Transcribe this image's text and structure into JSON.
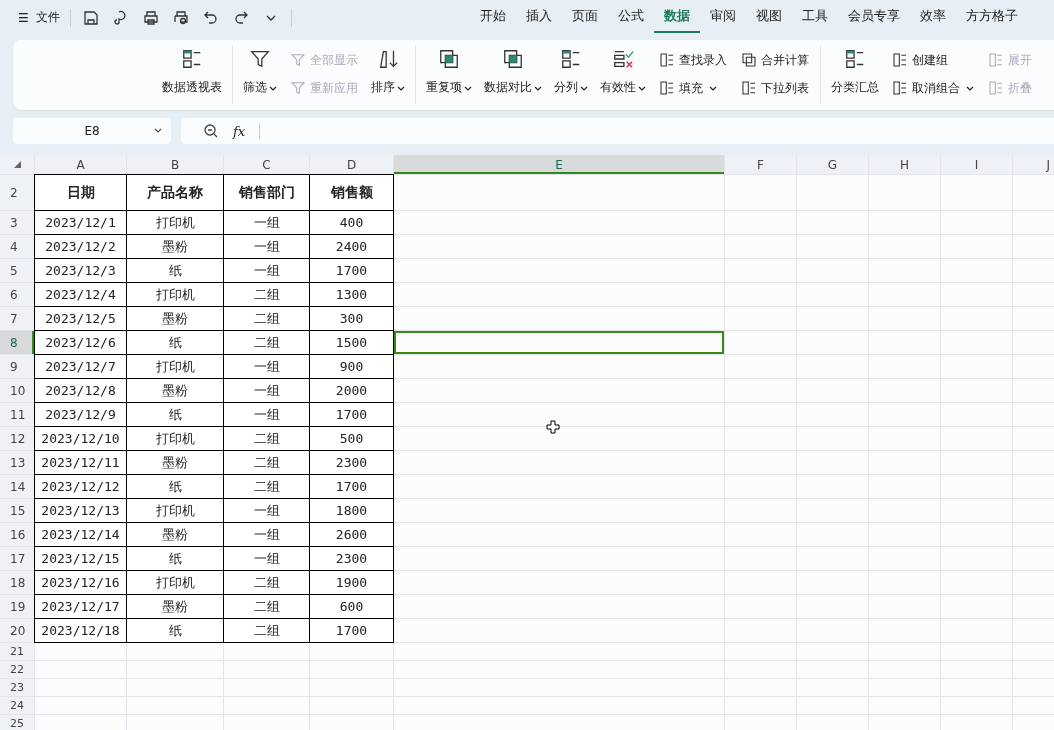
{
  "menu": {
    "label": "文件",
    "icon": "☰"
  },
  "tabs": [
    {
      "label": "开始",
      "selected": false
    },
    {
      "label": "插入",
      "selected": false
    },
    {
      "label": "页面",
      "selected": false
    },
    {
      "label": "公式",
      "selected": false
    },
    {
      "label": "数据",
      "selected": true
    },
    {
      "label": "审阅",
      "selected": false
    },
    {
      "label": "视图",
      "selected": false
    },
    {
      "label": "工具",
      "selected": false
    },
    {
      "label": "会员专享",
      "selected": false
    },
    {
      "label": "效率",
      "selected": false
    },
    {
      "label": "方方格子",
      "selected": false
    }
  ],
  "ribbon": [
    {
      "items": [
        {
          "kind": "large",
          "label": "数据透视表",
          "dropdown": false,
          "disabled": false
        }
      ]
    },
    {
      "items": [
        {
          "kind": "large",
          "label": "筛选",
          "dropdown": true,
          "disabled": false
        },
        {
          "kind": "stack",
          "items": [
            {
              "label": "全部显示",
              "dropdown": false,
              "disabled": true
            },
            {
              "label": "重新应用",
              "dropdown": false,
              "disabled": true
            }
          ]
        },
        {
          "kind": "large",
          "label": "排序",
          "dropdown": true,
          "disabled": false
        }
      ]
    },
    {
      "items": [
        {
          "kind": "large",
          "label": "重复项",
          "dropdown": true,
          "disabled": false
        },
        {
          "kind": "large",
          "label": "数据对比",
          "dropdown": true,
          "disabled": false
        },
        {
          "kind": "large",
          "label": "分列",
          "dropdown": true,
          "disabled": false
        },
        {
          "kind": "large",
          "label": "有效性",
          "dropdown": true,
          "disabled": false
        },
        {
          "kind": "stack",
          "items": [
            {
              "label": "查找录入",
              "dropdown": false,
              "disabled": false
            },
            {
              "label": "填充",
              "dropdown": true,
              "disabled": false
            }
          ]
        },
        {
          "kind": "stack",
          "items": [
            {
              "label": "合并计算",
              "dropdown": false,
              "disabled": false
            },
            {
              "label": "下拉列表",
              "dropdown": false,
              "disabled": false
            }
          ]
        }
      ]
    },
    {
      "items": [
        {
          "kind": "large",
          "label": "分类汇总",
          "dropdown": false,
          "disabled": false
        },
        {
          "kind": "stack",
          "items": [
            {
              "label": "创建组",
              "dropdown": false,
              "disabled": false
            },
            {
              "label": "取消组合",
              "dropdown": true,
              "disabled": false
            }
          ]
        },
        {
          "kind": "stack",
          "items": [
            {
              "label": "展开",
              "dropdown": false,
              "disabled": true
            },
            {
              "label": "折叠",
              "dropdown": false,
              "disabled": true
            }
          ]
        }
      ]
    }
  ],
  "name_box": "E8",
  "fx": "fx",
  "columns": [
    {
      "label": "A",
      "selected": false
    },
    {
      "label": "B",
      "selected": false
    },
    {
      "label": "C",
      "selected": false
    },
    {
      "label": "D",
      "selected": false
    },
    {
      "label": "E",
      "selected": true
    },
    {
      "label": "F",
      "selected": false
    },
    {
      "label": "G",
      "selected": false
    },
    {
      "label": "H",
      "selected": false
    },
    {
      "label": "I",
      "selected": false
    },
    {
      "label": "J",
      "selected": false
    }
  ],
  "rows": [
    {
      "label": "2",
      "selected": false,
      "kind": "header",
      "cells": [
        "日期",
        "产品名称",
        "销售部门",
        "销售额"
      ]
    },
    {
      "label": "3",
      "selected": false,
      "kind": "data",
      "cells": [
        "2023/12/1",
        "打印机",
        "一组",
        "400"
      ]
    },
    {
      "label": "4",
      "selected": false,
      "kind": "data",
      "cells": [
        "2023/12/2",
        "墨粉",
        "一组",
        "2400"
      ]
    },
    {
      "label": "5",
      "selected": false,
      "kind": "data",
      "cells": [
        "2023/12/3",
        "纸",
        "一组",
        "1700"
      ]
    },
    {
      "label": "6",
      "selected": false,
      "kind": "data",
      "cells": [
        "2023/12/4",
        "打印机",
        "二组",
        "1300"
      ]
    },
    {
      "label": "7",
      "selected": false,
      "kind": "data",
      "cells": [
        "2023/12/5",
        "墨粉",
        "二组",
        "300"
      ]
    },
    {
      "label": "8",
      "selected": true,
      "kind": "data",
      "cells": [
        "2023/12/6",
        "纸",
        "二组",
        "1500"
      ]
    },
    {
      "label": "9",
      "selected": false,
      "kind": "data",
      "cells": [
        "2023/12/7",
        "打印机",
        "一组",
        "900"
      ]
    },
    {
      "label": "10",
      "selected": false,
      "kind": "data",
      "cells": [
        "2023/12/8",
        "墨粉",
        "一组",
        "2000"
      ]
    },
    {
      "label": "11",
      "selected": false,
      "kind": "data",
      "cells": [
        "2023/12/9",
        "纸",
        "一组",
        "1700"
      ]
    },
    {
      "label": "12",
      "selected": false,
      "kind": "data",
      "cells": [
        "2023/12/10",
        "打印机",
        "二组",
        "500"
      ]
    },
    {
      "label": "13",
      "selected": false,
      "kind": "data",
      "cells": [
        "2023/12/11",
        "墨粉",
        "二组",
        "2300"
      ]
    },
    {
      "label": "14",
      "selected": false,
      "kind": "data",
      "cells": [
        "2023/12/12",
        "纸",
        "二组",
        "1700"
      ]
    },
    {
      "label": "15",
      "selected": false,
      "kind": "data",
      "cells": [
        "2023/12/13",
        "打印机",
        "一组",
        "1800"
      ]
    },
    {
      "label": "16",
      "selected": false,
      "kind": "data",
      "cells": [
        "2023/12/14",
        "墨粉",
        "一组",
        "2600"
      ]
    },
    {
      "label": "17",
      "selected": false,
      "kind": "data",
      "cells": [
        "2023/12/15",
        "纸",
        "一组",
        "2300"
      ]
    },
    {
      "label": "18",
      "selected": false,
      "kind": "data",
      "cells": [
        "2023/12/16",
        "打印机",
        "二组",
        "1900"
      ]
    },
    {
      "label": "19",
      "selected": false,
      "kind": "data",
      "cells": [
        "2023/12/17",
        "墨粉",
        "二组",
        "600"
      ]
    },
    {
      "label": "20",
      "selected": false,
      "kind": "data",
      "cells": [
        "2023/12/18",
        "纸",
        "二组",
        "1700"
      ]
    },
    {
      "label": "21",
      "selected": false,
      "kind": "empty"
    },
    {
      "label": "22",
      "selected": false,
      "kind": "empty"
    },
    {
      "label": "23",
      "selected": false,
      "kind": "empty"
    },
    {
      "label": "24",
      "selected": false,
      "kind": "empty"
    },
    {
      "label": "25",
      "selected": false,
      "kind": "empty"
    }
  ]
}
